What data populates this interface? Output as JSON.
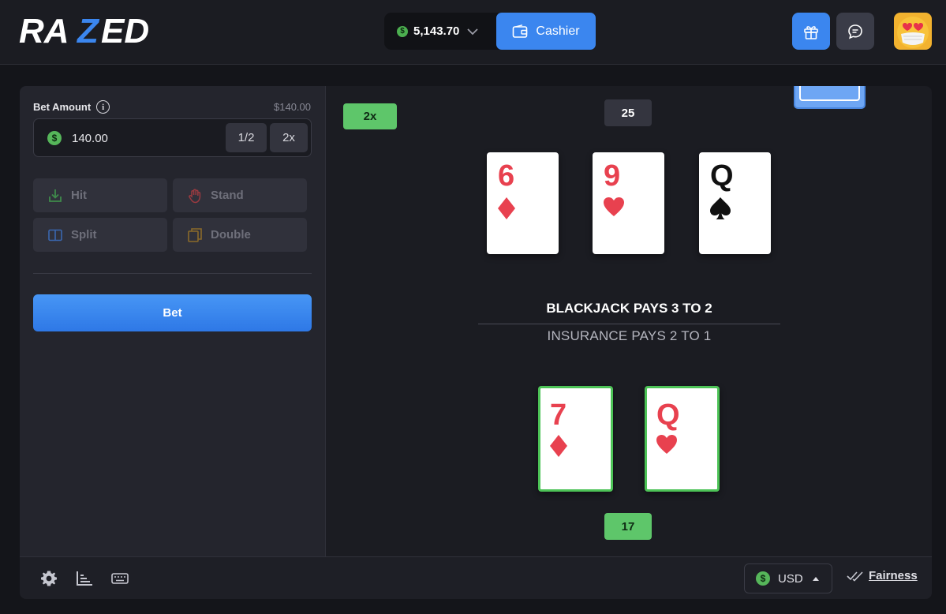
{
  "header": {
    "logo_text": "RAZED",
    "balance": "5,143.70",
    "cashier_label": "Cashier"
  },
  "sidebar": {
    "bet_amount_label": "Bet Amount",
    "bet_amount_usd": "$140.00",
    "bet_value": "140.00",
    "half_label": "1/2",
    "double_mult_label": "2x",
    "actions": {
      "hit": "Hit",
      "stand": "Stand",
      "split": "Split",
      "double": "Double"
    },
    "bet_button": "Bet"
  },
  "table": {
    "payout_badge": "2x",
    "dealer_total": "25",
    "dealer_cards": [
      {
        "rank": "6",
        "suit": "diamonds",
        "color": "red"
      },
      {
        "rank": "9",
        "suit": "hearts",
        "color": "red"
      },
      {
        "rank": "Q",
        "suit": "spades",
        "color": "black"
      }
    ],
    "rule_blackjack": "BLACKJACK PAYS 3 TO 2",
    "rule_insurance": "INSURANCE PAYS 2 TO 1",
    "player_cards": [
      {
        "rank": "7",
        "suit": "diamonds",
        "color": "red"
      },
      {
        "rank": "Q",
        "suit": "hearts",
        "color": "red"
      }
    ],
    "player_total": "17"
  },
  "footer": {
    "settings_icon": "gear-icon",
    "stats_icon": "bar-chart-icon",
    "hotkeys_icon": "keyboard-icon",
    "currency": "USD",
    "fairness_label": "Fairness"
  },
  "colors": {
    "accent_blue": "#3b86ef",
    "win_green": "#5ec66a",
    "badge_gray": "#34353f",
    "card_red": "#e8414f",
    "panel_bg": "#24252d"
  }
}
